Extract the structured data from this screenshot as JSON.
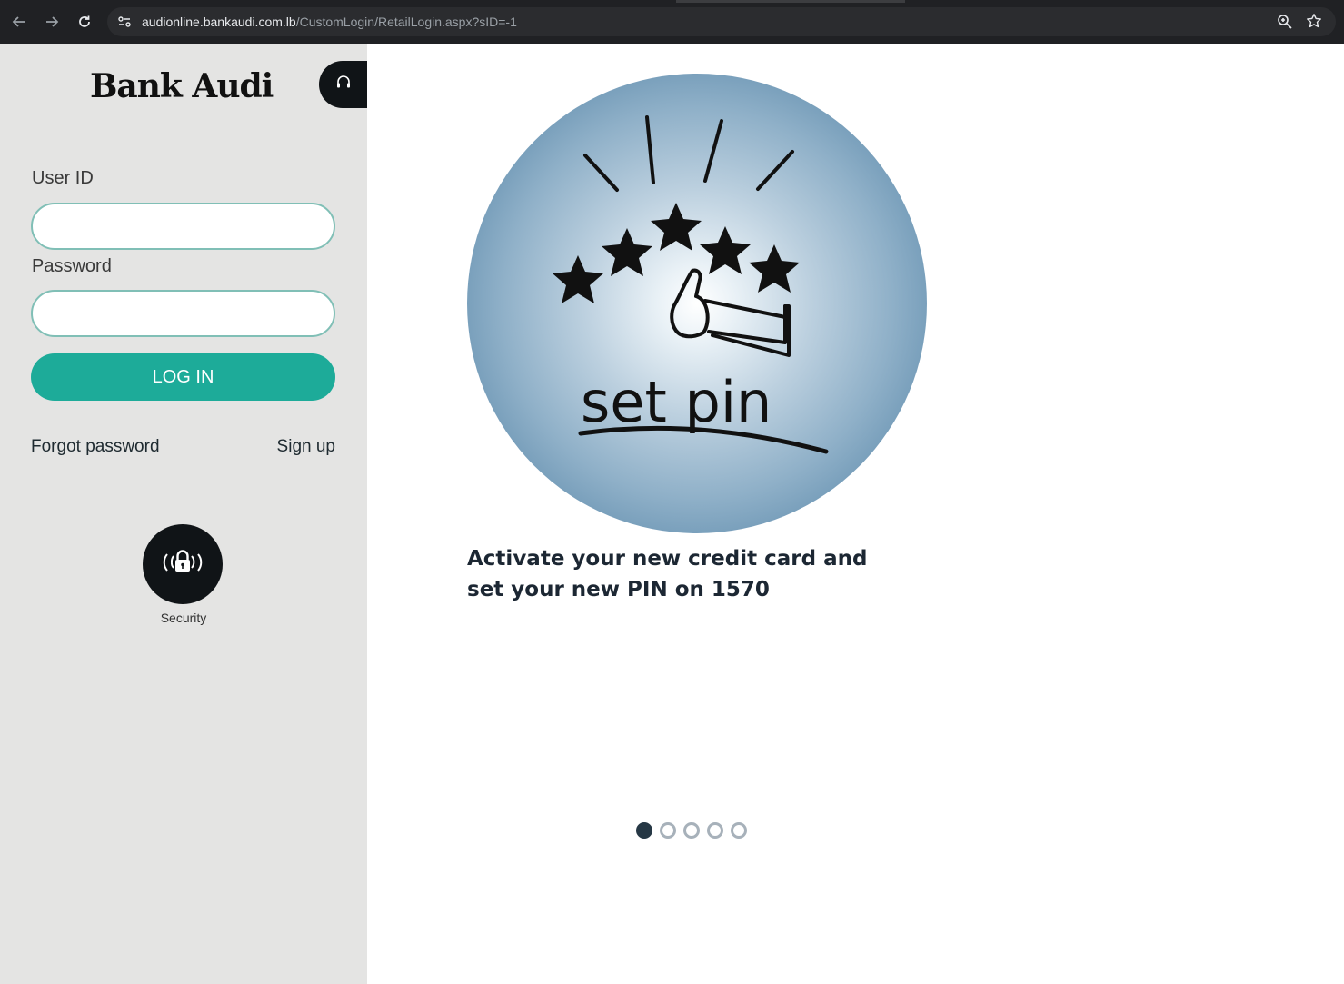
{
  "browser": {
    "url_host": "audionline.bankaudi.com.lb",
    "url_path": "/CustomLogin/RetailLogin.aspx?sID=-1",
    "icons": [
      "back-arrow-icon",
      "forward-arrow-icon",
      "reload-icon",
      "site-info-icon",
      "zoom-icon",
      "bookmark-star-icon"
    ]
  },
  "sidebar": {
    "logo": "Bank Audi",
    "help_icon": "headset-icon",
    "user_id_label": "User ID",
    "user_id_value": "",
    "password_label": "Password",
    "password_value": "",
    "login_label": "LOG IN",
    "forgot_label": "Forgot password",
    "signup_label": "Sign up",
    "security_icon": "lock-signal-icon",
    "security_label": "Security"
  },
  "promo": {
    "image_text": "set pin",
    "caption": "Activate your new credit card and set your new PIN on 1570",
    "slide_count": 5,
    "active_slide": 1
  },
  "colors": {
    "accent": "#1dab99",
    "input_border": "#80bfb6",
    "sidebar_bg": "#e4e4e3",
    "dark": "#101417"
  }
}
